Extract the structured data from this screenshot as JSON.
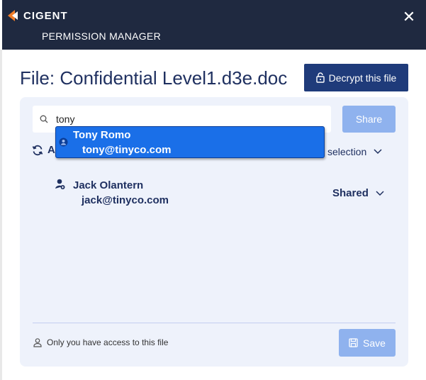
{
  "titlebar": {
    "logo_text": "CIGENT",
    "subtitle": "PERMISSION MANAGER",
    "close_label": "✕"
  },
  "file": {
    "title": "File: Confidential Level1.d3e.doc",
    "decrypt_label": "Decrypt this file"
  },
  "search": {
    "value": "tony",
    "placeholder": ""
  },
  "share_label": "Share",
  "list_header": {
    "partial_label": "A",
    "selection_label": "selection"
  },
  "users": [
    {
      "name": "Jack Olantern",
      "email": "jack@tinyco.com",
      "permission": "Shared"
    }
  ],
  "suggestion": {
    "name": "Tony Romo",
    "email": "tony@tinyco.com"
  },
  "footer": {
    "access_note": "Only you have access to this file",
    "save_label": "Save"
  },
  "colors": {
    "titlebar": "#1f2940",
    "accent": "#1f3b7a",
    "panel": "#eef2fb",
    "disabled_button": "#8fb2ee",
    "suggestion_highlight": "#1a6fe8",
    "logo_orange": "#f07d2a"
  }
}
